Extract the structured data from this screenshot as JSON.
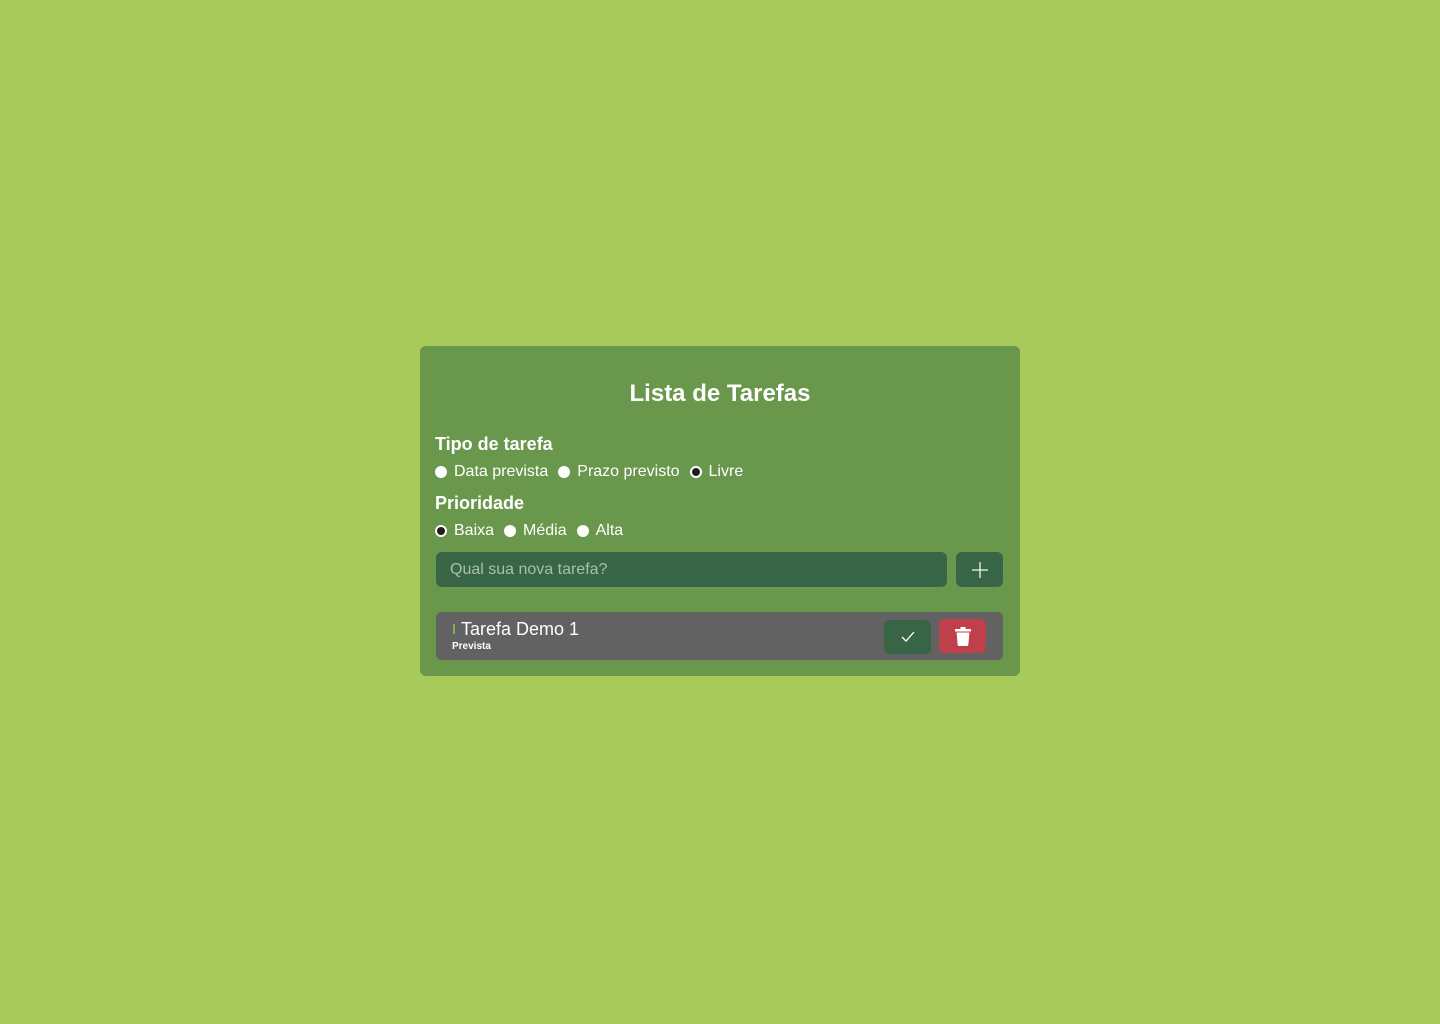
{
  "app": {
    "title": "Lista de Tarefas"
  },
  "task_type": {
    "label": "Tipo de tarefa",
    "options": [
      "Data prevista",
      "Prazo previsto",
      "Livre"
    ],
    "selected": "Livre"
  },
  "priority": {
    "label": "Prioridade",
    "options": [
      "Baixa",
      "Média",
      "Alta"
    ],
    "selected": "Baixa"
  },
  "new_task": {
    "placeholder": "Qual sua nova tarefa?",
    "value": "",
    "add_icon": "plus-icon"
  },
  "tasks": [
    {
      "name": "Tarefa Demo 1",
      "type": "Prevista",
      "done_icon": "check-icon",
      "delete_icon": "trash-icon"
    }
  ],
  "colors": {
    "background": "#a8ca5a",
    "card": "#69974c",
    "input": "#376545",
    "task_item": "#626262",
    "done_button": "#376545",
    "delete_button": "#c0404a"
  }
}
